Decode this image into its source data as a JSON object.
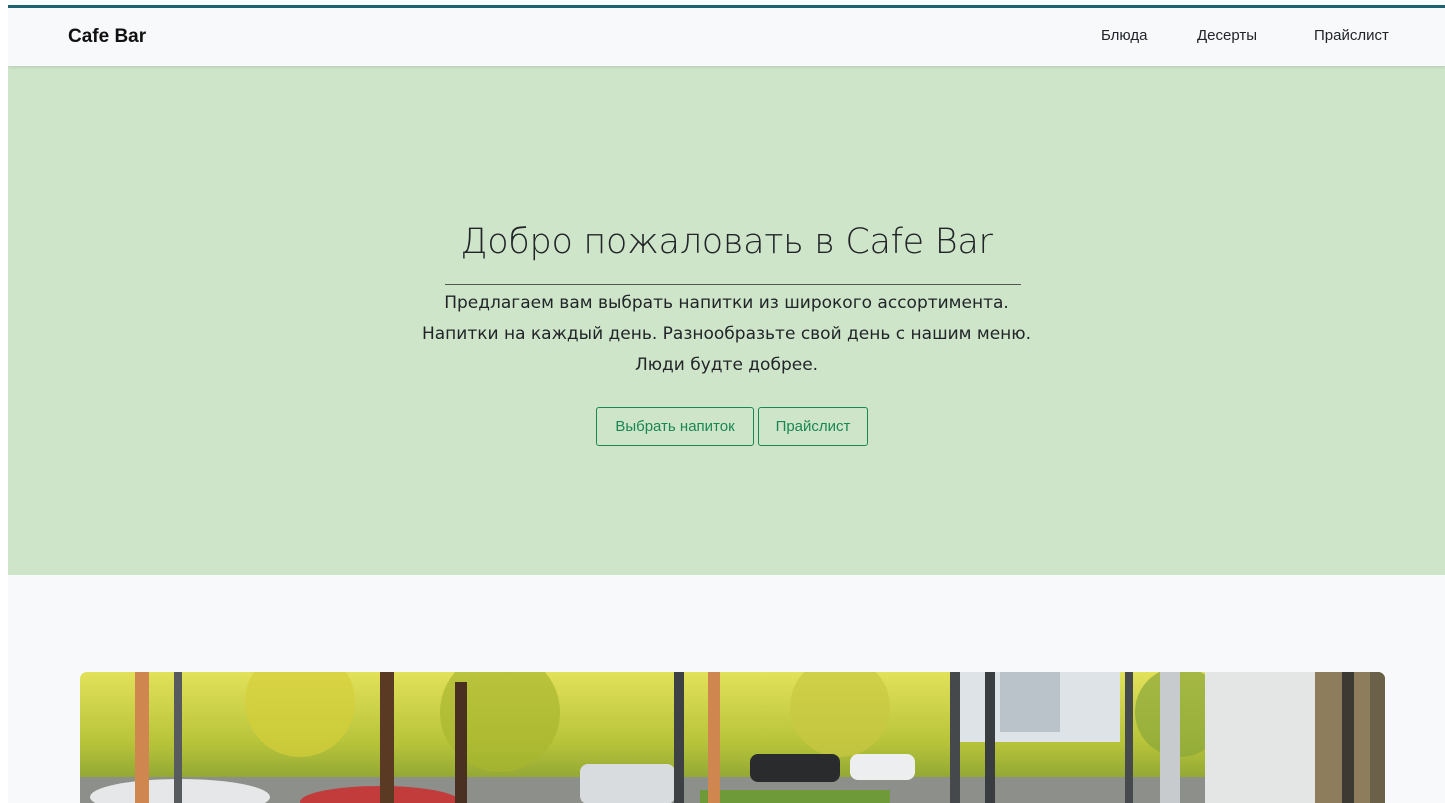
{
  "navbar": {
    "brand": "Cafe Bar",
    "links": [
      {
        "label": "Блюда"
      },
      {
        "label": "Десерты"
      },
      {
        "label": "Прайслист"
      }
    ]
  },
  "hero": {
    "title": "Добро пожаловать в Cafe Bar",
    "lines": [
      "Предлагаем вам выбрать напитки из широкого ассортимента.",
      "Напитки на каждый день. Разнообразьте свой день с нашим меню.",
      "Люди будте добрее."
    ],
    "buttons": {
      "choose": "Выбрать напиток",
      "pricelist": "Прайслист"
    }
  },
  "colors": {
    "hero_bg": "#cfe5c9",
    "accent": "#198754",
    "top_border": "#1d6470",
    "page_bg": "#f8f9fa"
  }
}
